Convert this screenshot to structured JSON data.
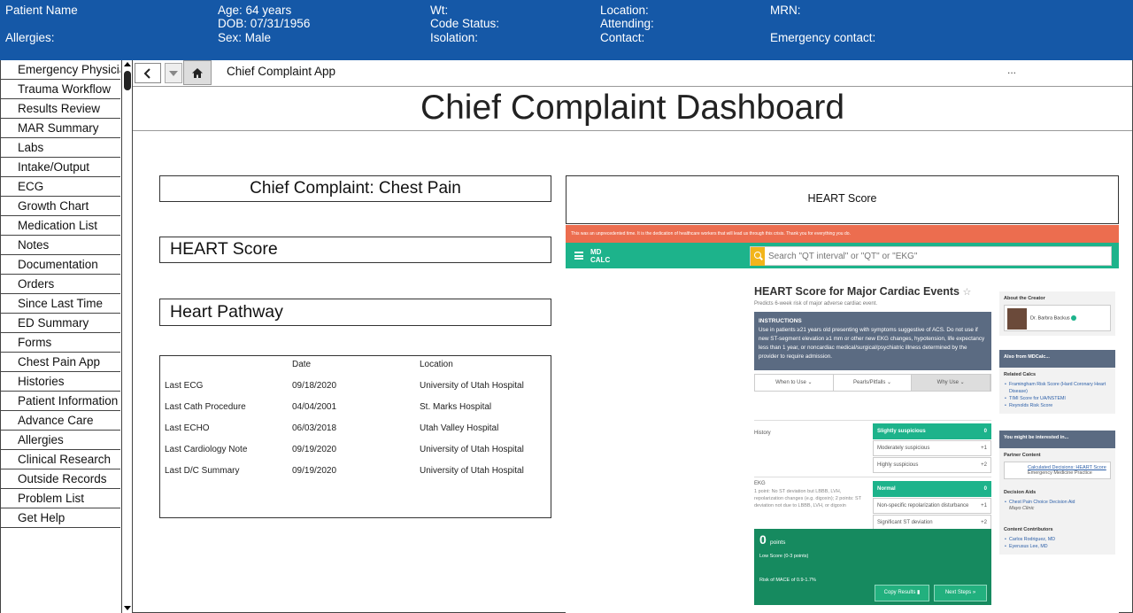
{
  "banner": {
    "patient_name": "Patient Name",
    "allergies": "Allergies:",
    "age": "Age: 64 years",
    "dob": "DOB: 07/31/1956",
    "sex": "Sex: Male",
    "wt": "Wt:",
    "code_status": "Code Status:",
    "isolation": "Isolation:",
    "location": "Location:",
    "attending": "Attending:",
    "contact": "Contact:",
    "mrn": "MRN:",
    "emergency_contact": "Emergency contact:",
    "background_color": "#1558a7"
  },
  "sidebar": {
    "items": [
      "Emergency Physicia",
      "Trauma Workflow",
      "Results Review",
      "MAR Summary",
      "Labs",
      "Intake/Output",
      "ECG",
      "Growth Chart",
      "Medication List",
      "Notes",
      "Documentation",
      "Orders",
      "Since Last Time",
      "ED Summary",
      "Forms",
      "Chest Pain App",
      "Histories",
      "Patient Information",
      "Advance Care",
      "Allergies",
      "Clinical Research",
      "Outside Records",
      "Problem List",
      "Get Help"
    ]
  },
  "navbar": {
    "back_icon": "chevron-left-icon",
    "dropdown_icon": "caret-down-icon",
    "home_icon": "home-icon",
    "tab_label": "Chief Complaint App",
    "overflow": "..."
  },
  "dashboard": {
    "title": "Chief Complaint Dashboard",
    "chief_complaint": "Chief Complaint: Chest Pain",
    "heart_score_label": "HEART Score",
    "heart_pathway_label": "Heart Pathway",
    "heart_score_panel_title": "HEART Score"
  },
  "encounters": {
    "headers": {
      "date": "Date",
      "location": "Location"
    },
    "rows": [
      {
        "label": "Last ECG",
        "date": "09/18/2020",
        "location": "University of Utah Hospital"
      },
      {
        "label": "Last Cath Procedure",
        "date": "04/04/2001",
        "location": "St. Marks Hospital"
      },
      {
        "label": "Last ECHO",
        "date": "06/03/2018",
        "location": "Utah Valley Hospital"
      },
      {
        "label": "Last Cardiology Note",
        "date": "09/19/2020",
        "location": "University of Utah Hospital"
      },
      {
        "label": "Last D/C Summary",
        "date": "09/19/2020",
        "location": "University of Utah Hospital"
      }
    ]
  },
  "mdcalc": {
    "banner_text": "This was an unprecedented time. It is the dedication of healthcare workers that will lead us through this crisis. Thank you for everything you do.",
    "logo_line1": "MD",
    "logo_line2": "CALC",
    "search_placeholder": "Search \"QT interval\" or \"QT\" or \"EKG\"",
    "title": "HEART Score for Major Cardiac Events",
    "star": "☆",
    "subtitle": "Predicts 6-week risk of major adverse cardiac event.",
    "instructions_title": "INSTRUCTIONS",
    "instructions_text": "Use in patients ≥21 years old presenting with symptoms suggestive of ACS. Do not use if new ST-segment elevation ≥1 mm or other new EKG changes, hypotension, life expectancy less than 1 year, or noncardiac medical/surgical/psychiatric illness determined by the provider to require admission.",
    "tabs": [
      "When to Use ⌄",
      "Pearls/Pitfalls ⌄",
      "Why Use ⌄"
    ],
    "history_label": "History",
    "history_options": [
      {
        "label": "Slightly suspicious",
        "points": "0",
        "selected": true
      },
      {
        "label": "Moderately suspicious",
        "points": "+1",
        "selected": false
      },
      {
        "label": "Highly suspicious",
        "points": "+2",
        "selected": false
      }
    ],
    "ekg_label": "EKG",
    "ekg_desc": "1 point: No ST deviation but LBBB, LVH, repolarization changes (e.g. digoxin); 2 points: ST deviation not due to LBBB, LVH, or digoxin",
    "ekg_options": [
      {
        "label": "Normal",
        "points": "0",
        "selected": true
      },
      {
        "label": "Non-specific repolarization disturbance",
        "points": "+1",
        "selected": false
      },
      {
        "label": "Significant ST deviation",
        "points": "+2",
        "selected": false
      }
    ],
    "result_points": "0",
    "result_points_word": "points",
    "result_low": "Low Score (0-3 points)",
    "result_risk": "Risk of MACE of 0.9-1.7%",
    "copy_results": "Copy Results ▮",
    "next_steps": "Next Steps »",
    "about_creator": "About the Creator",
    "creator_name": "Dr. Barbra Backus",
    "also_from": "Also from MDCalc...",
    "related_calcs_label": "Related Calcs",
    "related_calcs": [
      "Framingham Risk Score (Hard Coronary Heart Disease)",
      "TIMI Score for UA/NSTEMI",
      "Reynolds Risk Score"
    ],
    "might_be_interested": "You might be interested in...",
    "partner_content_label": "Partner Content",
    "partner_link": "Calculated Decisions: HEART Score",
    "partner_source": "Emergency Medicine Practice",
    "decision_aids_label": "Decision Aids",
    "decision_aid_link": "Chest Pain Choice Decision Aid",
    "decision_aid_source": "Mayo Clinic",
    "contributors_label": "Content Contributors",
    "contributors": [
      "Carlos Rodriguez, MD",
      "Eyerusus Lee, MD"
    ],
    "colors": {
      "red": "#ec6d4f",
      "green": "#1db38b",
      "dark_green": "#168a5f",
      "slate": "#5b6b82"
    }
  }
}
